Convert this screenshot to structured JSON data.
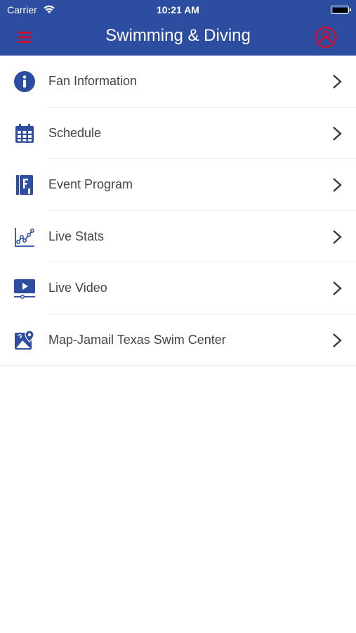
{
  "status_bar": {
    "carrier": "Carrier",
    "time": "10:21 AM"
  },
  "header": {
    "title": "Swimming & Diving",
    "menu_icon": "hamburger-menu-icon",
    "profile_icon": "user-profile-icon"
  },
  "colors": {
    "header_bg": "#2d4ea0",
    "accent_red": "#c8102e",
    "icon_blue": "#2d4ea0",
    "label_text": "#454545",
    "chevron": "#333333"
  },
  "menu": {
    "items": [
      {
        "label": "Fan Information",
        "icon": "info-icon"
      },
      {
        "label": "Schedule",
        "icon": "calendar-icon"
      },
      {
        "label": "Event Program",
        "icon": "program-book-icon"
      },
      {
        "label": "Live Stats",
        "icon": "line-chart-icon"
      },
      {
        "label": "Live Video",
        "icon": "video-play-icon"
      },
      {
        "label": "Map-Jamail Texas Swim Center",
        "icon": "map-pin-icon"
      }
    ]
  }
}
